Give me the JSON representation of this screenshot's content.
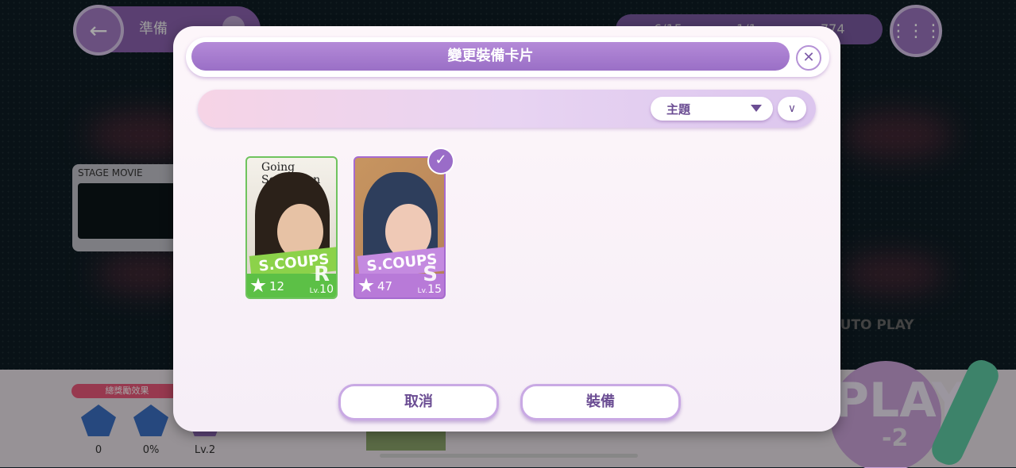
{
  "top_bar": {
    "title": "準備",
    "resources": [
      "6/15",
      "1/1",
      "774"
    ]
  },
  "stage_movie": {
    "label": "STAGE MOVIE"
  },
  "bottom": {
    "bonus_label": "總獎勵效果",
    "stats": [
      {
        "value": "0",
        "icon": "upgrade-plus-icon"
      },
      {
        "value": "0%",
        "icon": "upgrade-book-icon"
      },
      {
        "value": "Lv.2",
        "icon": "level-icon"
      }
    ],
    "auto_play": "AUTO PLAY",
    "play_cost": "-2"
  },
  "modal": {
    "title": "變更裝備卡片",
    "sort_label": "主題",
    "cards": [
      {
        "name": "S.COUPS",
        "stars": "12",
        "rarity": "R",
        "level_prefix": "Lv.",
        "level": "10",
        "magazine": "Going Seventeen",
        "equipped": false
      },
      {
        "name": "S.COUPS",
        "stars": "47",
        "rarity": "S",
        "level_prefix": "Lv.",
        "level": "15",
        "equipped": true
      }
    ],
    "cancel_label": "取消",
    "confirm_label": "裝備"
  },
  "colors": {
    "accent": "#9a6fc6",
    "rarity_r": "#5cc046",
    "rarity_s": "#b87ad8"
  }
}
